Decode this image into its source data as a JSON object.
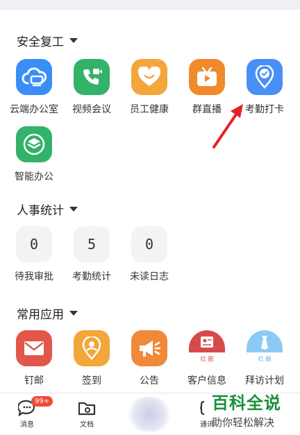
{
  "sections": {
    "safe": {
      "title": "安全复工",
      "apps": [
        {
          "label": "云端办公室",
          "icon": "cloud-office-icon",
          "color": "#3a8ef6"
        },
        {
          "label": "视频会议",
          "icon": "video-call-icon",
          "color": "#33b26a"
        },
        {
          "label": "员工健康",
          "icon": "heart-icon",
          "color": "#f3a63a"
        },
        {
          "label": "群直播",
          "icon": "tv-live-icon",
          "color": "#f08a2a"
        },
        {
          "label": "考勤打卡",
          "icon": "location-check-icon",
          "color": "#4a8ff7"
        },
        {
          "label": "智能办公",
          "icon": "smart-layers-icon",
          "color": "#33b26a"
        }
      ]
    },
    "hr": {
      "title": "人事统计",
      "stats": [
        {
          "value": "0",
          "label": "待我审批"
        },
        {
          "value": "5",
          "label": "考勤统计"
        },
        {
          "value": "0",
          "label": "未读日志"
        }
      ]
    },
    "common": {
      "title": "常用应用",
      "apps": [
        {
          "label": "钉邮",
          "icon": "mail-icon",
          "color": "#e2574a"
        },
        {
          "label": "签到",
          "icon": "checkin-pin-icon",
          "color": "#f3a63a"
        },
        {
          "label": "公告",
          "icon": "megaphone-icon",
          "color": "#f08a3a"
        },
        {
          "label": "客户信息",
          "icon": "customer-card-icon",
          "color": "#d84a4a",
          "tag": "红 圈"
        },
        {
          "label": "拜访计划",
          "icon": "visit-plan-icon",
          "color": "#5aaef0",
          "tag": "红 圈"
        }
      ]
    }
  },
  "tabbar": {
    "tabs": [
      {
        "label": "消息",
        "icon": "chat-bubble-icon",
        "badge": "99+"
      },
      {
        "label": "文档",
        "icon": "folder-icon"
      },
      {
        "label": "通讯",
        "icon": "contacts-icon"
      }
    ]
  },
  "watermark": {
    "main": "百科全说",
    "sub": "助你轻松解决"
  },
  "colors": {
    "arrow": "#e5202a",
    "watermark_green": "#1a8f3a"
  }
}
